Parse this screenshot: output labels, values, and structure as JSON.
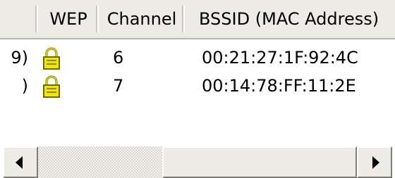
{
  "columns": {
    "cut_partial": "",
    "wep": "WEP",
    "channel": "Channel",
    "bssid": "BSSID (MAC Address)"
  },
  "rows": [
    {
      "cut_text": "9)",
      "wep_icon": "lock-icon",
      "channel": "6",
      "bssid": "00:21:27:1F:92:4C"
    },
    {
      "cut_text": ")",
      "wep_icon": "lock-icon",
      "channel": "7",
      "bssid": "00:14:78:FF:11:2E"
    }
  ],
  "scrollbar": {
    "left_icon": "scroll-left-icon",
    "right_icon": "scroll-right-icon",
    "position_fraction": 0.38,
    "visible_fraction": 0.62
  },
  "colors": {
    "lock_body": "#f5e600",
    "lock_outline": "#6b6a00"
  }
}
